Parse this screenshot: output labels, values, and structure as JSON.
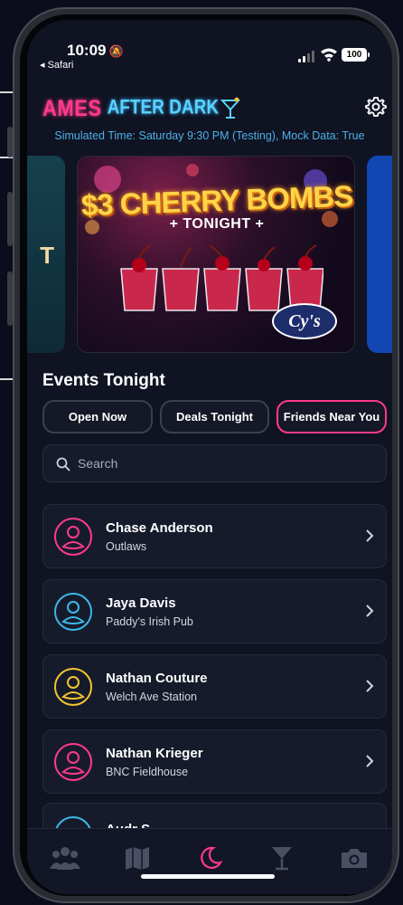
{
  "status_bar": {
    "time": "10:09",
    "back_label": "◂ Safari",
    "battery": "100"
  },
  "header": {
    "logo_left": "AMES",
    "logo_right": "AFTER DARK",
    "simulated_line": "Simulated Time: Saturday 9:30 PM (Testing), Mock Data: True"
  },
  "carousel": {
    "promo_title": "$3 CHERRY BOMBS",
    "promo_subtitle": "+ TONIGHT +",
    "brand": "Cy's",
    "left_mark": "T"
  },
  "events": {
    "title": "Events Tonight",
    "filters": [
      {
        "label": "Open Now",
        "active": false
      },
      {
        "label": "Deals Tonight",
        "active": false
      },
      {
        "label": "Friends Near You",
        "active": true
      }
    ],
    "search_placeholder": "Search",
    "people": [
      {
        "name": "Chase Anderson",
        "venue": "Outlaws",
        "color": "#ff3a8c"
      },
      {
        "name": "Jaya Davis",
        "venue": "Paddy's Irish Pub",
        "color": "#3ab8e8"
      },
      {
        "name": "Nathan Couture",
        "venue": "Welch Ave Station",
        "color": "#f2c431"
      },
      {
        "name": "Nathan Krieger",
        "venue": "BNC Fieldhouse",
        "color": "#ff3a8c"
      }
    ],
    "partial_row": {
      "name": "Audr S",
      "color": "#3ab8e8"
    }
  },
  "tabbar": {
    "tabs": [
      {
        "icon": "people-icon",
        "active": false
      },
      {
        "icon": "map-icon",
        "active": false
      },
      {
        "icon": "moon-icon",
        "active": true
      },
      {
        "icon": "cocktail-icon",
        "active": false
      },
      {
        "icon": "camera-icon",
        "active": false
      }
    ]
  },
  "colors": {
    "accent_pink": "#ff3a8c",
    "accent_blue": "#3ab8e8",
    "accent_yellow": "#f2c431",
    "background": "#0f1322"
  }
}
